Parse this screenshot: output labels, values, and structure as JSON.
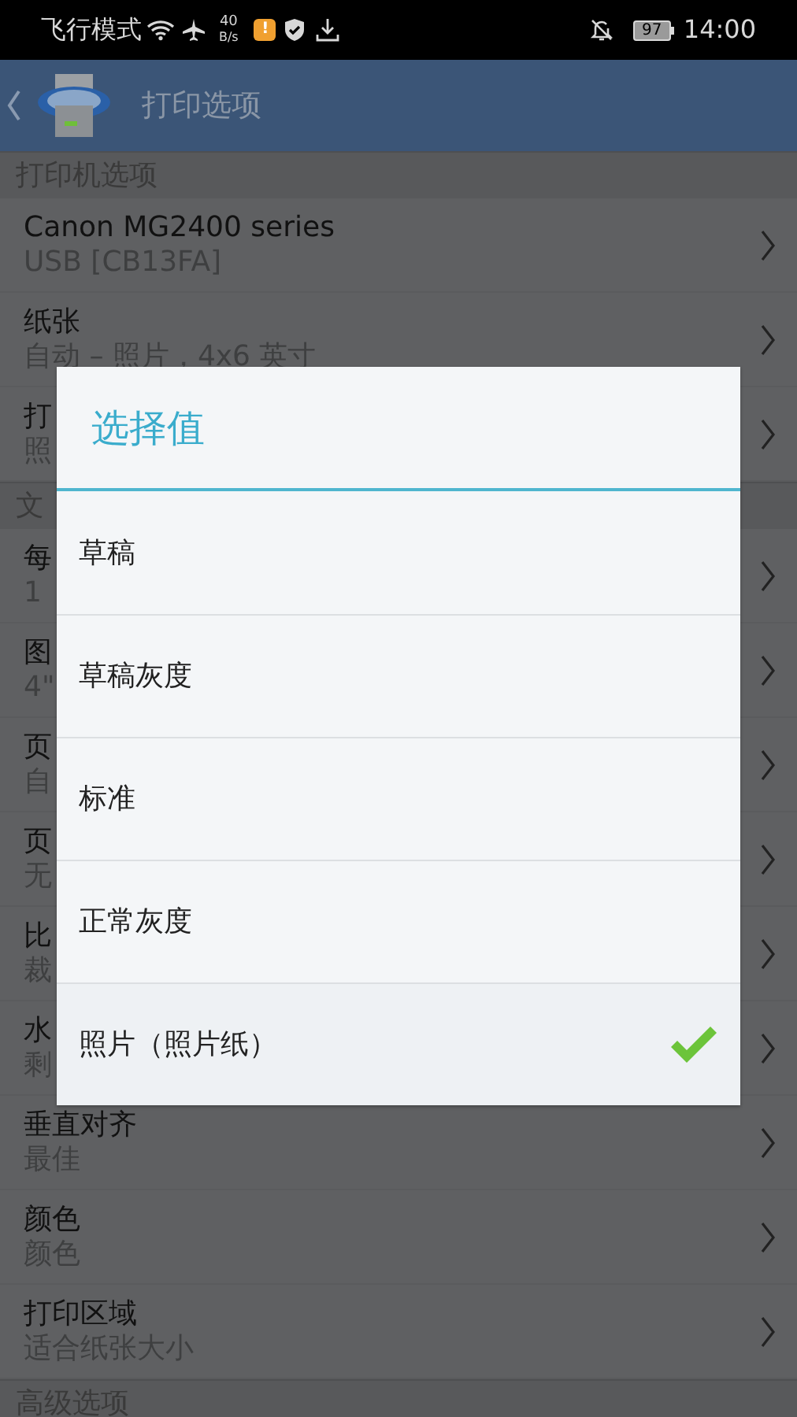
{
  "status_bar": {
    "mode": "飞行模式",
    "speed_value": "40",
    "speed_unit": "B/s",
    "alert": "!",
    "battery": "97",
    "time": "14:00"
  },
  "header": {
    "title": "打印选项"
  },
  "list": [
    {
      "kind": "section",
      "title": "打印机选项"
    },
    {
      "kind": "setting",
      "title": "Canon MG2400 series",
      "value": "USB [CB13FA]"
    },
    {
      "kind": "setting",
      "title": "纸张",
      "value": "自动 – 照片，4x6 英寸"
    },
    {
      "kind": "setting",
      "title": "打",
      "value": "照"
    },
    {
      "kind": "section",
      "title": "文"
    },
    {
      "kind": "setting",
      "title": "每",
      "value": "1"
    },
    {
      "kind": "setting",
      "title": "图",
      "value": "4\""
    },
    {
      "kind": "setting",
      "title": "页",
      "value": "自"
    },
    {
      "kind": "setting",
      "title": "页",
      "value": "无"
    },
    {
      "kind": "setting",
      "title": "比",
      "value": "裁"
    },
    {
      "kind": "setting",
      "title": "水",
      "value": "剩"
    },
    {
      "kind": "setting",
      "title": "垂直对齐",
      "value": "最佳"
    },
    {
      "kind": "setting",
      "title": "颜色",
      "value": "颜色"
    },
    {
      "kind": "setting",
      "title": "打印区域",
      "value": "适合纸张大小"
    },
    {
      "kind": "section",
      "title": "高级选项"
    }
  ],
  "dialog": {
    "title": "选择值",
    "options": [
      {
        "label": "草稿",
        "selected": false
      },
      {
        "label": "草稿灰度",
        "selected": false
      },
      {
        "label": "标准",
        "selected": false
      },
      {
        "label": "正常灰度",
        "selected": false
      },
      {
        "label": "照片（照片纸）",
        "selected": true
      }
    ]
  }
}
